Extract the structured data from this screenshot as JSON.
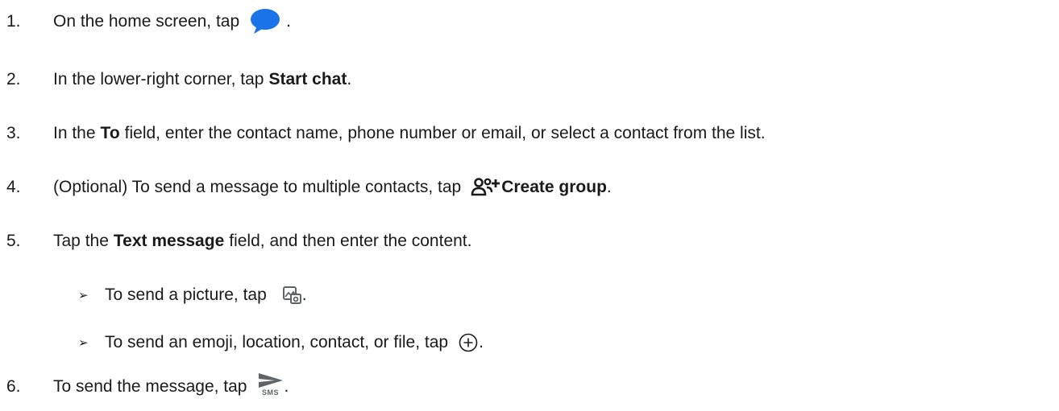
{
  "steps": [
    {
      "num": "1.",
      "before": "On the home screen, tap",
      "icon": "messages-app-icon",
      "after": "."
    },
    {
      "num": "2.",
      "before": "In the lower-right corner, tap",
      "bold": "Start chat",
      "after": "."
    },
    {
      "num": "3.",
      "before": "In the",
      "bold": "To",
      "after": "field, enter the contact name, phone number or email, or select a contact from the list."
    },
    {
      "num": "4.",
      "before": "(Optional) To send a message to multiple contacts, tap",
      "icon": "create-group-icon",
      "bold": "Create group",
      "after": "."
    },
    {
      "num": "5.",
      "before": "Tap the",
      "bold": "Text message",
      "after": "field, and then enter the content."
    },
    {
      "num": "6.",
      "before": "To send the message, tap",
      "icon": "send-sms-icon",
      "icon_label": "SMS",
      "after": "."
    }
  ],
  "substeps": [
    {
      "bullet": "➢",
      "before": "To send a picture, tap",
      "icon": "gallery-icon",
      "after": "."
    },
    {
      "bullet": "➢",
      "before": "To send an emoji, location, contact, or file, tap",
      "icon": "add-circle-icon",
      "after": "."
    }
  ],
  "colors": {
    "text": "#1a1a1a",
    "messages_blue": "#1a73e8",
    "icon_gray": "#5f6368"
  }
}
